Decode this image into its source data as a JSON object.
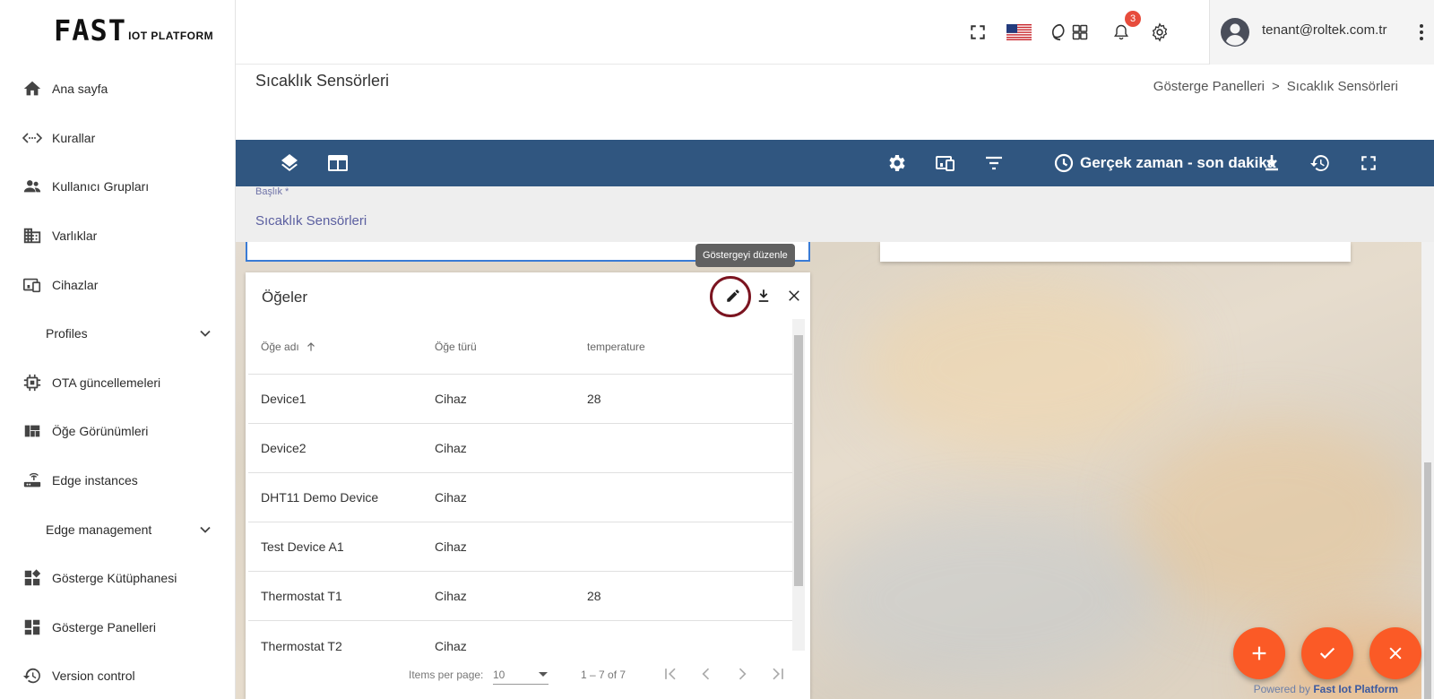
{
  "logo": {
    "big": "FAST",
    "small": "IOT PLATFORM"
  },
  "sidebar": {
    "items": [
      {
        "label": "Ana sayfa",
        "icon": "home-icon"
      },
      {
        "label": "Kurallar",
        "icon": "rule-chain-icon"
      },
      {
        "label": "Kullanıcı Grupları",
        "icon": "user-group-icon"
      },
      {
        "label": "Varlıklar",
        "icon": "domain-icon"
      },
      {
        "label": "Cihazlar",
        "icon": "devices-icon"
      },
      {
        "label": "Profiles",
        "icon": "chevron-down-icon",
        "expandable": true
      },
      {
        "label": "OTA güncellemeleri",
        "icon": "memory-chip-icon"
      },
      {
        "label": "Öğe Görünümleri",
        "icon": "view-quilt-icon"
      },
      {
        "label": "Edge instances",
        "icon": "router-icon"
      },
      {
        "label": "Edge management",
        "icon": "chevron-down-icon",
        "expandable": true
      },
      {
        "label": "Gösterge Kütüphanesi",
        "icon": "widgets-icon"
      },
      {
        "label": "Gösterge Panelleri",
        "icon": "dashboard-icon"
      },
      {
        "label": "Version control",
        "icon": "history-icon"
      }
    ]
  },
  "topbar": {
    "notification_count": "3",
    "user_email": "tenant@roltek.com.tr"
  },
  "page": {
    "title": "Sıcaklık Sensörleri",
    "breadcrumb": [
      "Gösterge Panelleri",
      ">",
      "Sıcaklık Sensörleri"
    ]
  },
  "dashboard_toolbar": {
    "timewindow": "Gerçek zaman - son dakika"
  },
  "title_edit": {
    "label": "Başlık *",
    "value": "Sıcaklık Sensörleri"
  },
  "widget": {
    "title": "Öğeler",
    "tooltip": "Göstergeyi düzenle",
    "columns": [
      "Öğe adı",
      "Öğe türü",
      "temperature"
    ],
    "rows": [
      [
        "Device1",
        "Cihaz",
        "28"
      ],
      [
        "Device2",
        "Cihaz",
        ""
      ],
      [
        "DHT11 Demo Device",
        "Cihaz",
        ""
      ],
      [
        "Test Device A1",
        "Cihaz",
        ""
      ],
      [
        "Thermostat T1",
        "Cihaz",
        "28"
      ],
      [
        "Thermostat T2",
        "Cihaz",
        ""
      ]
    ],
    "paginator": {
      "items_per_page_label": "Items per page:",
      "items_per_page": "10",
      "range": "1 – 7 of 7"
    }
  },
  "footer": {
    "powered_prefix": "Powered by",
    "powered_brand": "Fast Iot Platform"
  },
  "colors": {
    "toolbar": "#305680",
    "fab": "#fb5a26",
    "highlight": "#7b1420",
    "accent": "#5b5fa0"
  }
}
